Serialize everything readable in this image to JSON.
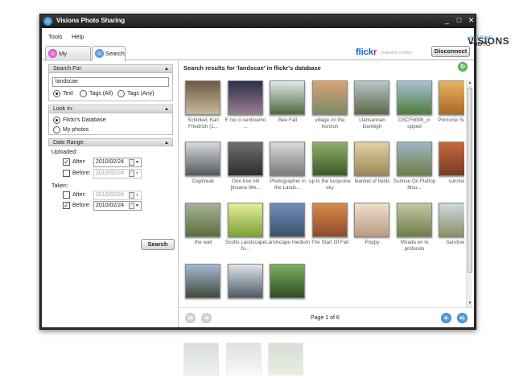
{
  "window": {
    "title": "Visions Photo Sharing",
    "minimize": "_",
    "maximize": "□",
    "close": "✕"
  },
  "menu": {
    "tools": "Tools",
    "help": "Help"
  },
  "brand": {
    "visions": "VISIONS",
    "photo": "PHOTO",
    "sharing": "SHARING"
  },
  "tabs": {
    "my_account": "My Account",
    "search": "Search"
  },
  "flickr": {
    "flick": "flick",
    "r": "r",
    "user": "maxam.cohen",
    "disconnect": "Disconnect"
  },
  "search_for": {
    "header": "Search For:",
    "value": "landscae",
    "options": [
      "Text",
      "Tags (All)",
      "Tags (Any)"
    ],
    "selected": "Text"
  },
  "look_in": {
    "header": "Look In:",
    "options": [
      "Flickr's Database",
      "My photos"
    ],
    "selected": "Flickr's Database"
  },
  "date_range": {
    "header": "Date Range:",
    "uploaded": "Uploaded:",
    "taken": "Taken:",
    "after": "After:",
    "before": "Before:",
    "uploaded_after": "2010/02/24",
    "uploaded_before": "2010/02/24",
    "taken_after": "2010/02/24",
    "taken_before": "2010/02/24"
  },
  "search_button": "Search",
  "results": {
    "heading": "Search results for 'landscae' in flickr's database",
    "items": [
      {
        "caption": "Schinkel, Karl Friedrich (1...",
        "c1": "#6a5a45",
        "c2": "#c9b99b"
      },
      {
        "caption": "E noi ci sentivamo ...",
        "c1": "#2b2f4a",
        "c2": "#9a7f8f"
      },
      {
        "caption": "Bee Fall",
        "c1": "#dfe8e8",
        "c2": "#4e6a42"
      },
      {
        "caption": "village on the horizon",
        "c1": "#d9a276",
        "c2": "#7a8a65"
      },
      {
        "caption": "Llansannan Denbigh",
        "c1": "#b9c5c9",
        "c2": "#5b6a4a"
      },
      {
        "caption": "DSCF6099_cr opped",
        "c1": "#a9c2d8",
        "c2": "#4d7d3a"
      },
      {
        "caption": "Primorsk Sunset",
        "c1": "#e9b45e",
        "c2": "#a8682a"
      },
      {
        "caption": "Daybreak",
        "c1": "#d7d9dc",
        "c2": "#555a5e"
      },
      {
        "caption": "One tree hill [Insane We...",
        "c1": "#6f6f6f",
        "c2": "#2e2e2e"
      },
      {
        "caption": "Photographer in the Lands...",
        "c1": "#dadada",
        "c2": "#7a7a7a"
      },
      {
        "caption": "up in the turquoise sky",
        "c1": "#8fb06a",
        "c2": "#3d5b28"
      },
      {
        "caption": "blanket of fields",
        "c1": "#e3d1a6",
        "c2": "#9b8a56"
      },
      {
        "caption": "Sunrise On Flattop Mou...",
        "c1": "#9fb6c8",
        "c2": "#6e7f45"
      },
      {
        "caption": "sunrise",
        "c1": "#c56a3e",
        "c2": "#7a3a22"
      },
      {
        "caption": "the wall",
        "c1": "#a6b39a",
        "c2": "#5a6d3a"
      },
      {
        "caption": "Scotts Landscape fo...",
        "c1": "#e6ec9a",
        "c2": "#7aa235"
      },
      {
        "caption": "Landscape medium",
        "c1": "#6e8fb8",
        "c2": "#3d4f6a"
      },
      {
        "caption": "The Start Of Fall",
        "c1": "#d98a4a",
        "c2": "#8c4b2a"
      },
      {
        "caption": "Poppy",
        "c1": "#efe0cc",
        "c2": "#b99b83"
      },
      {
        "caption": "Mirada en lo profundo",
        "c1": "#c4c6a8",
        "c2": "#6f7d46"
      },
      {
        "caption": "Sandown",
        "c1": "#cfd9e1",
        "c2": "#8a8f63"
      },
      {
        "caption": "",
        "c1": "#a5b9d2",
        "c2": "#3f4a3a"
      },
      {
        "caption": "",
        "c1": "#dfe4ea",
        "c2": "#4d5965"
      },
      {
        "caption": "",
        "c1": "#7fb05e",
        "c2": "#2f4b22"
      }
    ]
  },
  "pager": {
    "text": "Page 1 of 6",
    "first": "|◂",
    "prev": "◂",
    "next": "▸",
    "last": "▸|",
    "refresh": "↻"
  }
}
